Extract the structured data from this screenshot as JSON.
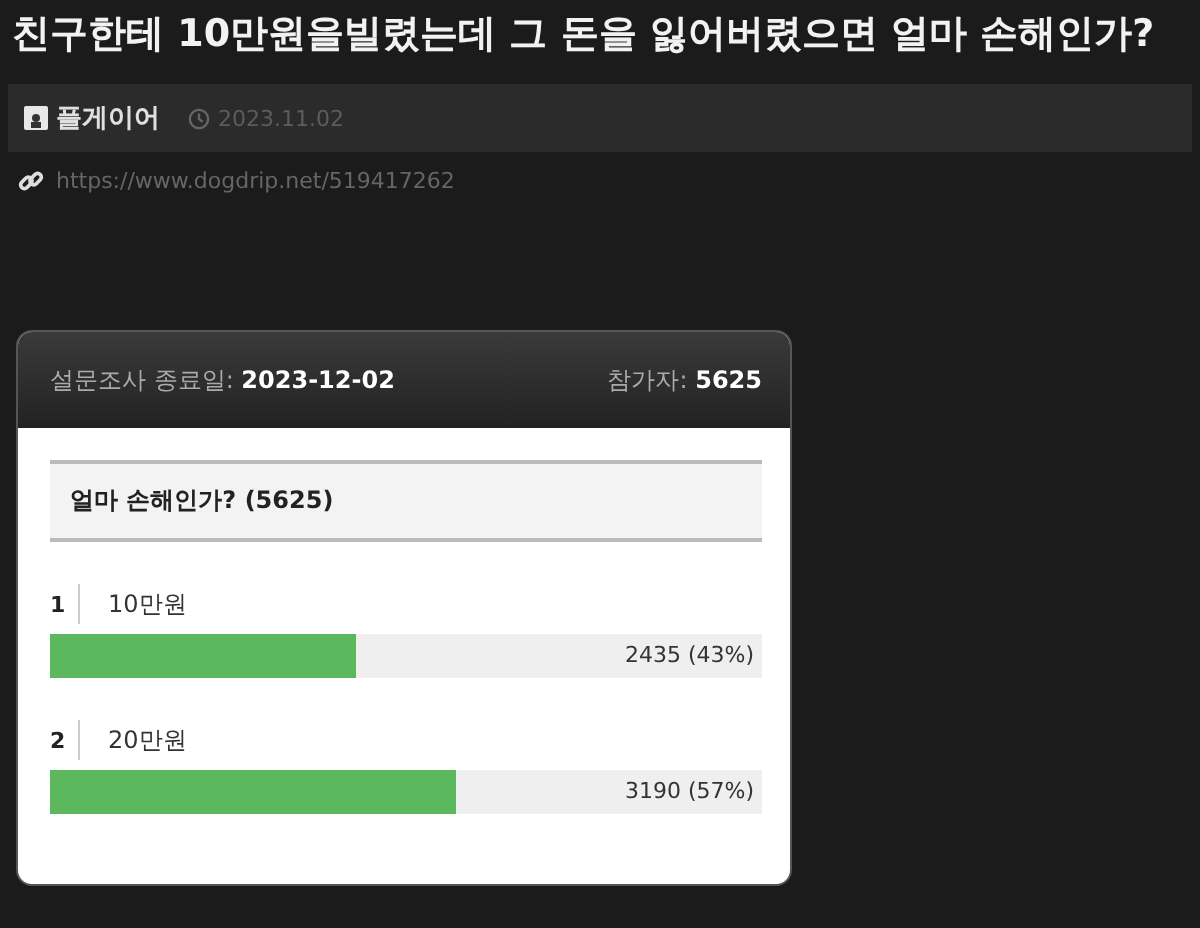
{
  "post": {
    "title": "친구한테 10만원을빌렸는데 그 돈을 잃어버렸으면 얼마 손해인가?",
    "author": "플게이어",
    "date": "2023.11.02",
    "url": "https://www.dogdrip.net/519417262"
  },
  "poll": {
    "end_label": "설문조사 종료일:",
    "end_date": "2023-12-02",
    "participants_label": "참가자:",
    "participants": "5625",
    "question": "얼마 손해인가? (5625)",
    "options": [
      {
        "number": "1",
        "label": "10만원",
        "level": 0.43,
        "result": "2435 (43%)"
      },
      {
        "number": "2",
        "label": "20만원",
        "level": 0.57,
        "result": "3190 (57%)"
      }
    ]
  }
}
